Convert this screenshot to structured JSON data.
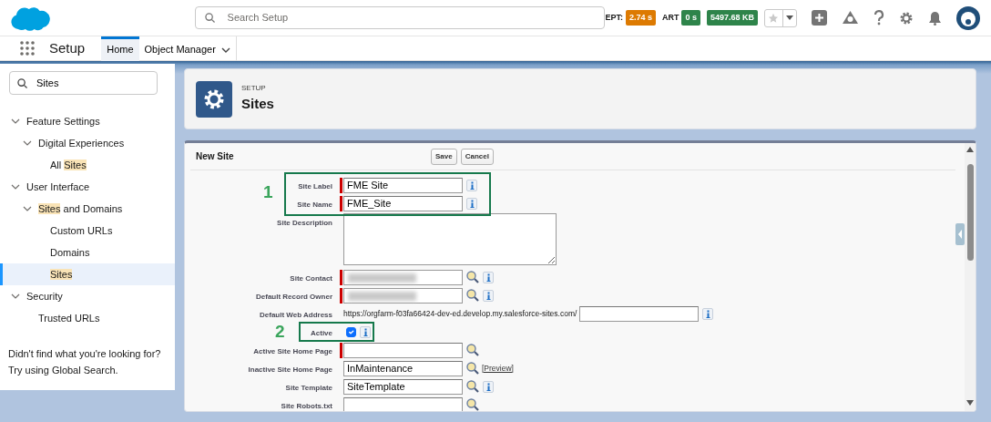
{
  "header": {
    "search": {
      "placeholder": "Search Setup"
    },
    "metrics": [
      {
        "label": "EPT:",
        "value": "2.74 s",
        "color": "#dd7a01"
      },
      {
        "label": "ART",
        "value": "0 s",
        "color": "#2e844a"
      },
      {
        "value": "5497.68 KB",
        "color": "#2e844a"
      }
    ],
    "favorite": {
      "on": false
    }
  },
  "nav": {
    "app_name": "Setup",
    "tabs": [
      {
        "label": "Home",
        "selected": true
      },
      {
        "label": "Object Manager",
        "selected": false,
        "has_menu": true
      }
    ]
  },
  "sidebar": {
    "search": {
      "value": "Sites"
    },
    "tree": [
      {
        "segments": [
          {
            "text": "Feature Settings"
          }
        ],
        "selected": false,
        "expanded": true,
        "children": [
          {
            "segments": [
              {
                "text": "Digital Experiences"
              }
            ],
            "selected": false,
            "expanded": true,
            "children": [
              {
                "segments": [
                  {
                    "text": "All "
                  },
                  {
                    "text": "Sites",
                    "match": true
                  }
                ],
                "selected": false
              }
            ]
          }
        ]
      },
      {
        "segments": [
          {
            "text": "User Interface"
          }
        ],
        "selected": false,
        "expanded": true,
        "children": [
          {
            "segments": [
              {
                "text": "Sites",
                "match": true
              },
              {
                "text": " and Domains"
              }
            ],
            "selected": false,
            "expanded": true,
            "children": [
              {
                "segments": [
                  {
                    "text": "Custom URLs"
                  }
                ],
                "selected": false
              },
              {
                "segments": [
                  {
                    "text": "Domains"
                  }
                ],
                "selected": false
              },
              {
                "segments": [
                  {
                    "text": "Sites",
                    "match": true
                  }
                ],
                "selected": true
              }
            ]
          }
        ]
      },
      {
        "segments": [
          {
            "text": "Security"
          }
        ],
        "selected": false,
        "expanded": true,
        "children": [
          {
            "segments": [
              {
                "text": "Trusted URLs"
              }
            ],
            "selected": false
          }
        ]
      }
    ],
    "footer": "Didn't find what you're looking for? Try using Global Search."
  },
  "page_header": {
    "eyebrow": "SETUP",
    "title": "Sites"
  },
  "form": {
    "title": "New Site",
    "buttons": [
      "Save",
      "Cancel"
    ],
    "rows": [
      {
        "kind": "callout",
        "number": "1",
        "rows": [
          {
            "label": "Site Label",
            "kind": "text",
            "required": true,
            "value": "FME Site",
            "info": true
          },
          {
            "label": "Site Name",
            "kind": "text",
            "required": true,
            "value": "FME_Site",
            "info": true
          }
        ]
      },
      {
        "label": "Site Description",
        "kind": "textarea"
      },
      {
        "label": "Site Contact",
        "kind": "blurred",
        "required": true,
        "lookup": true,
        "info": true
      },
      {
        "label": "Default Record Owner",
        "kind": "blurred",
        "required": true,
        "lookup": true,
        "info": true
      },
      {
        "label": "Default Web Address",
        "kind": "url",
        "prefix": "https://orgfarm-f03fa66424-dev-ed.develop.my.salesforce-sites.com/",
        "info": true
      },
      {
        "kind": "callout",
        "number": "2",
        "rows": [
          {
            "label": "Active",
            "kind": "checkbox",
            "checked": true,
            "info": true
          }
        ]
      },
      {
        "label": "Active Site Home Page",
        "kind": "text",
        "required": true,
        "lookup": true
      },
      {
        "label": "Inactive Site Home Page",
        "kind": "text",
        "value": "InMaintenance",
        "lookup": true,
        "link": "[Preview]"
      },
      {
        "label": "Site Template",
        "kind": "text",
        "value": "SiteTemplate",
        "lookup": true,
        "info": true
      },
      {
        "label": "Site Robots.txt",
        "kind": "text",
        "lookup": true
      }
    ]
  }
}
